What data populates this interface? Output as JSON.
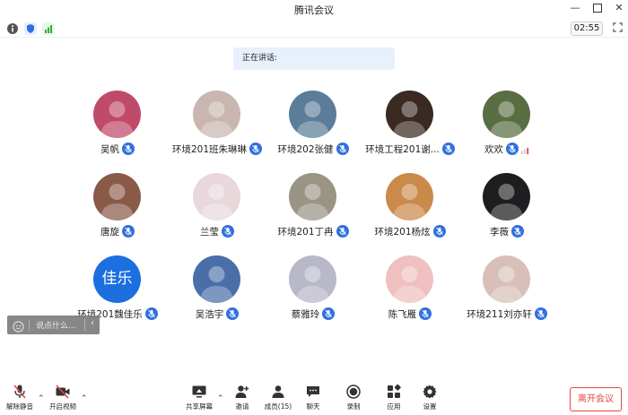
{
  "window": {
    "title": "腾讯会议",
    "timer": "02:55"
  },
  "speaking_label": "正在讲话:",
  "participants": [
    {
      "name": "吴帆",
      "avatar_color": "#c04a6a"
    },
    {
      "name": "环境201班朱琳琳",
      "avatar_color": "#c9b6b0"
    },
    {
      "name": "环境202张健",
      "avatar_color": "#5b7d99"
    },
    {
      "name": "环境工程201谢...",
      "avatar_color": "#3a2a22"
    },
    {
      "name": "欢欢",
      "avatar_color": "#5a6e44"
    },
    {
      "name": "唐旋",
      "avatar_color": "#8a5a48"
    },
    {
      "name": "兰莹",
      "avatar_color": "#e8d8dc"
    },
    {
      "name": "环境201丁冉",
      "avatar_color": "#9a9484"
    },
    {
      "name": "环境201杨炫",
      "avatar_color": "#c98a4a"
    },
    {
      "name": "李薇",
      "avatar_color": "#1e1e20"
    },
    {
      "name": "环境201魏佳乐",
      "avatar_color": "#1d6fe0",
      "avatar_text": "佳乐"
    },
    {
      "name": "吴浩宇",
      "avatar_color": "#4a6fa8"
    },
    {
      "name": "蔡雅玲",
      "avatar_color": "#b8b8c8"
    },
    {
      "name": "陈飞雁",
      "avatar_color": "#f0c0c0"
    },
    {
      "name": "环境211刘亦轩",
      "avatar_color": "#d8c0b8"
    }
  ],
  "chat": {
    "placeholder": "说点什么..."
  },
  "toolbar": {
    "unmute": "解除静音",
    "start_video": "开启视频",
    "share_screen": "共享屏幕",
    "invite": "邀请",
    "members": "成员(15)",
    "chat": "聊天",
    "record": "录制",
    "apps": "应用",
    "settings": "设置",
    "leave": "离开会议"
  },
  "colors": {
    "accent": "#2f6fe0",
    "leave": "#e54545"
  }
}
